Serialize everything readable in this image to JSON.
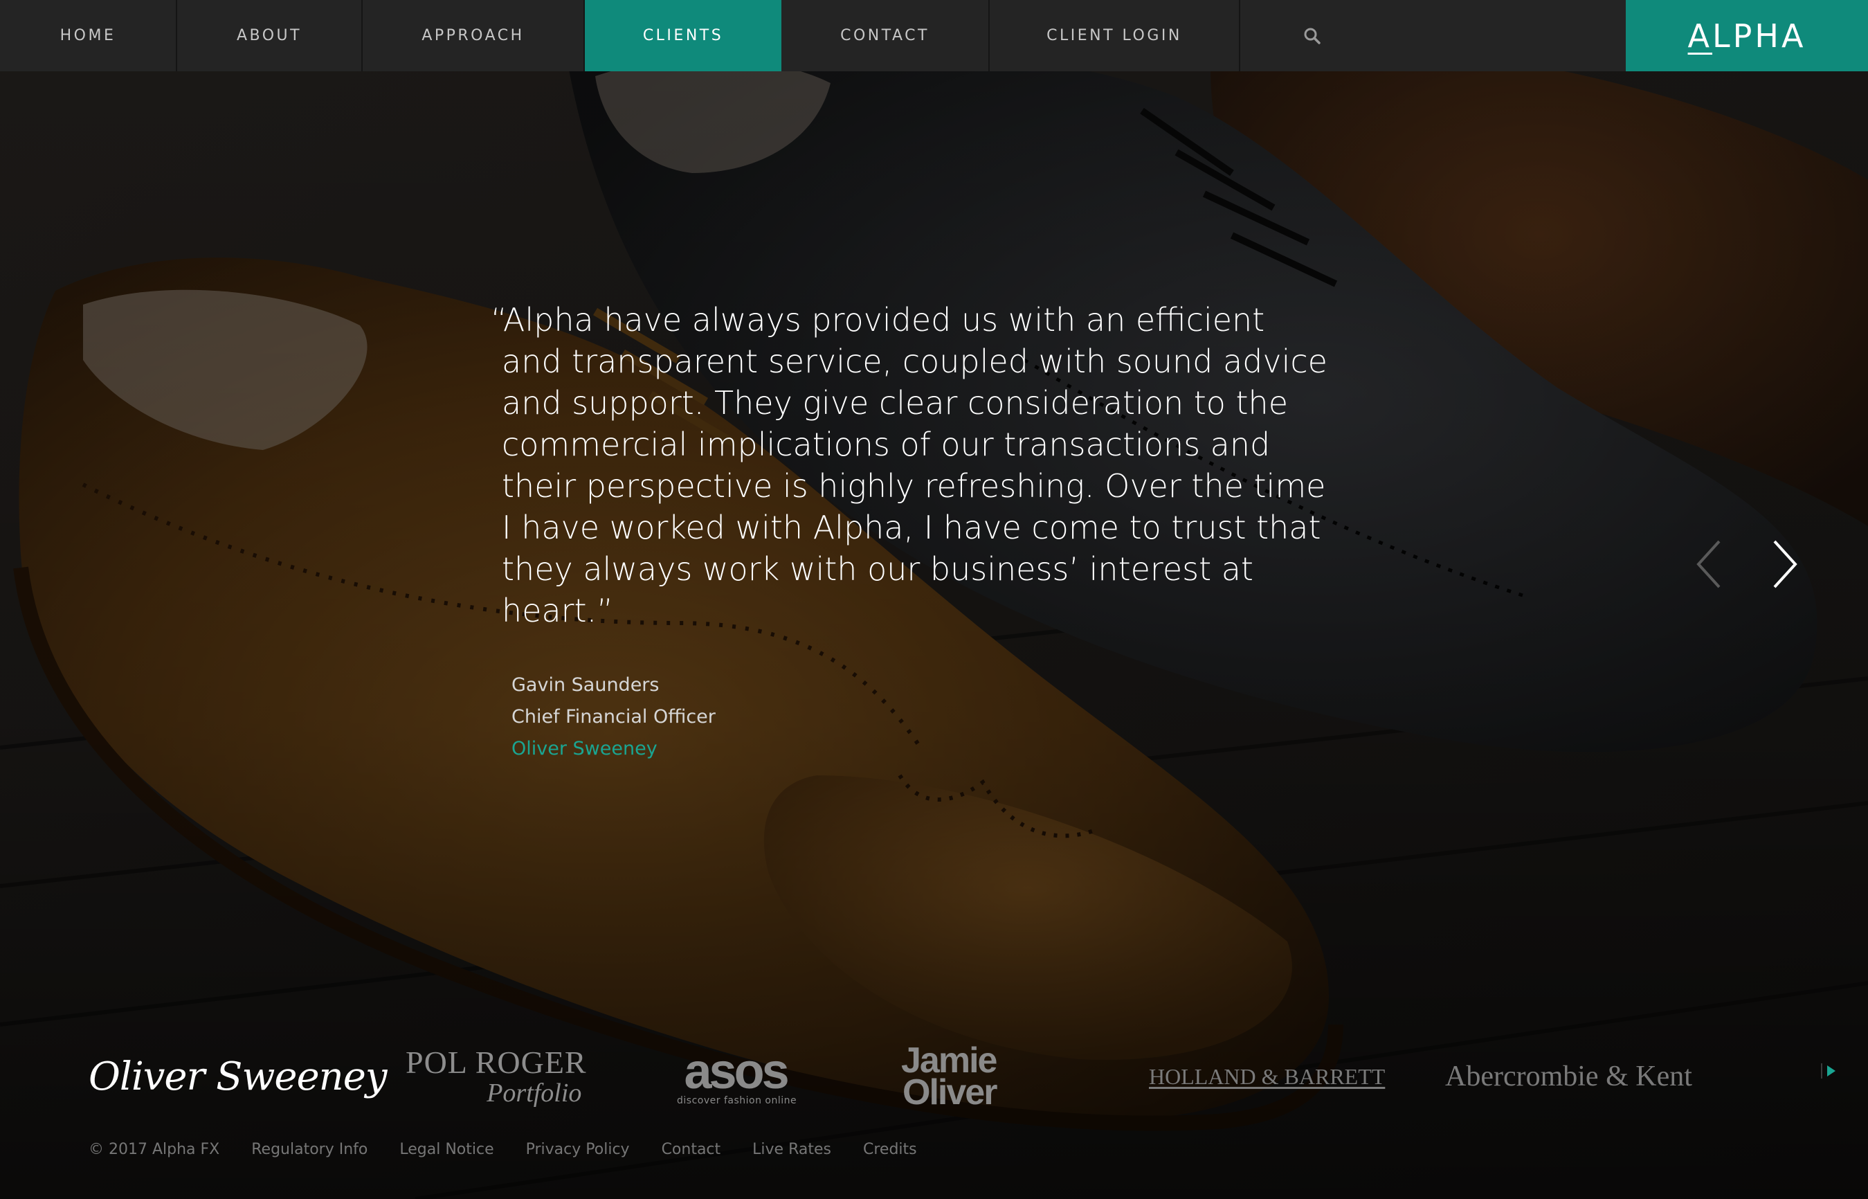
{
  "nav": {
    "items": [
      {
        "label": "HOME"
      },
      {
        "label": "ABOUT"
      },
      {
        "label": "APPROACH"
      },
      {
        "label": "CLIENTS"
      },
      {
        "label": "CONTACT"
      },
      {
        "label": "CLIENT LOGIN"
      }
    ],
    "active_item": "CLIENTS",
    "search_icon": "search-icon",
    "logo_first": "A",
    "logo_rest": "LPHA"
  },
  "testimonial": {
    "quote": "“Alpha have always provided us with an efficient and transparent service, coupled with sound advice and support. They give clear consideration to the commercial implications of our transactions and their perspective is highly refreshing. Over the time I have worked with Alpha, I have come to trust that they always work with our business’ interest at heart.”",
    "name": "Gavin Saunders",
    "role": "Chief Financial Officer",
    "company": "Oliver Sweeney"
  },
  "carousel": {
    "prev_icon": "chevron-left-icon",
    "next_icon": "chevron-right-icon"
  },
  "client_logos": {
    "oliver_sweeney": "Oliver Sweeney",
    "pol_roger_line1": "POL ROGER",
    "pol_roger_line2": "Portfolio",
    "asos_line1": "asos",
    "asos_line2": "discover fashion online",
    "jamie_line1": "Jamie",
    "jamie_line2": "Oliver",
    "holland_barrett": "HOLLAND & BARRETT",
    "abercrombie_kent": "Abercrombie & Kent",
    "next_icon": "play-right-icon"
  },
  "footer": {
    "copyright": "© 2017 Alpha FX",
    "links": [
      {
        "label": "Regulatory Info"
      },
      {
        "label": "Legal Notice"
      },
      {
        "label": "Privacy Policy"
      },
      {
        "label": "Contact"
      },
      {
        "label": "Live Rates"
      },
      {
        "label": "Credits"
      }
    ]
  },
  "colors": {
    "accent": "#0f8a7b",
    "company_link": "#1aa592",
    "nav_background": "#242424"
  }
}
